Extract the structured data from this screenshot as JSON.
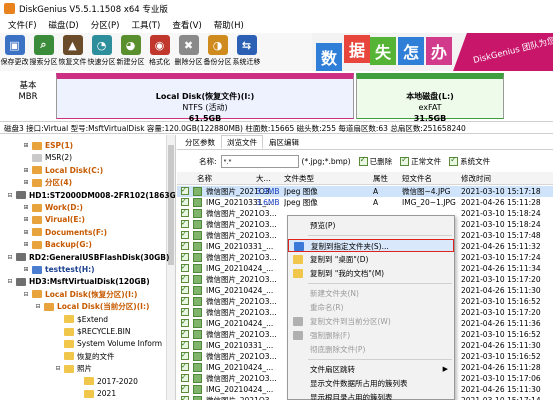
{
  "window": {
    "title": "DiskGenius V5.5.1.1508 x64 专业版"
  },
  "menu": [
    "文件(F)",
    "磁盘(D)",
    "分区(P)",
    "工具(T)",
    "查看(V)",
    "帮助(H)"
  ],
  "toolbar": [
    {
      "label": "保存更改",
      "icon": "save-icon",
      "color": "#3b72c4",
      "glyph": "▣"
    },
    {
      "label": "搜索分区",
      "icon": "search-partition-icon",
      "color": "#3a8b3a",
      "glyph": "⌕"
    },
    {
      "label": "恢复文件",
      "icon": "recover-file-icon",
      "color": "#6b4c2a",
      "glyph": "▲"
    },
    {
      "label": "快速分区",
      "icon": "quick-partition-icon",
      "color": "#2d8f9b",
      "glyph": "◔"
    },
    {
      "label": "新建分区",
      "icon": "new-partition-icon",
      "color": "#5a8f2e",
      "glyph": "◕"
    },
    {
      "label": "格式化",
      "icon": "format-icon",
      "color": "#c1372e",
      "glyph": "◉"
    },
    {
      "label": "删除分区",
      "icon": "delete-partition-icon",
      "color": "#8a8a8a",
      "glyph": "✖"
    },
    {
      "label": "备份分区",
      "icon": "backup-partition-icon",
      "color": "#d08b1f",
      "glyph": "◑"
    },
    {
      "label": "系统迁移",
      "icon": "system-migrate-icon",
      "color": "#2b60b5",
      "glyph": "⇆"
    }
  ],
  "banner": {
    "tiles": [
      {
        "char": "数",
        "color": "#2f7ed8"
      },
      {
        "char": "据",
        "color": "#e8453c"
      },
      {
        "char": "失",
        "color": "#55b435"
      },
      {
        "char": "怎",
        "color": "#2f7ed8"
      },
      {
        "char": "办",
        "color": "#d23b8c"
      }
    ],
    "ribbon_text": "DiskGenius 团队为您"
  },
  "diskmap": {
    "disk_label_line1": "基本",
    "disk_label_line2": "MBR",
    "partitions": [
      {
        "name": "Local Disk(恢复文件)(I:)",
        "fs": "NTFS (活动)",
        "size": "61.5GB",
        "color": "#eef2ff",
        "bar": "#cd2f82"
      },
      {
        "name": "本地磁盘(L:)",
        "fs": "exFAT",
        "size": "31.5GB",
        "color": "#eefbea",
        "bar": "#3f9f3f"
      }
    ]
  },
  "diskinfo": "磁盘3 接口:Virtual  型号:MsftVirtualDisk  容量:120.0GB(122880MB)  柱面数:15665  磁头数:255  每道扇区数:63  总扇区数:251658240",
  "tree": [
    {
      "exp": "⊞",
      "label": "ESP(1)",
      "style": "orange",
      "icon": "#e8a33c",
      "indent": 22
    },
    {
      "exp": "",
      "label": "MSR(2)",
      "style": "plain",
      "icon": "#c9c9c9",
      "indent": 22
    },
    {
      "exp": "⊞",
      "label": "Local Disk(C:)",
      "style": "orange",
      "icon": "#e8a33c",
      "indent": 22
    },
    {
      "exp": "⊞",
      "label": "分区(4)",
      "style": "orange",
      "icon": "#e8a33c",
      "indent": 22
    },
    {
      "exp": "⊟",
      "label": "HD1:ST2000DM008-2FR102(1863G",
      "style": "disk",
      "icon": "#6f6f6f",
      "indent": 6
    },
    {
      "exp": "⊞",
      "label": "Work(D:)",
      "style": "orange",
      "icon": "#e8a33c",
      "indent": 22
    },
    {
      "exp": "⊞",
      "label": "Virual(E:)",
      "style": "orange",
      "icon": "#e8a33c",
      "indent": 22
    },
    {
      "exp": "⊞",
      "label": "Documents(F:)",
      "style": "orange",
      "icon": "#e8a33c",
      "indent": 22
    },
    {
      "exp": "⊞",
      "label": "Backup(G:)",
      "style": "orange",
      "icon": "#e8a33c",
      "indent": 22
    },
    {
      "exp": "⊟",
      "label": "RD2:GeneralUSBFlashDisk(30GB)",
      "style": "disk",
      "icon": "#6f6f6f",
      "indent": 6
    },
    {
      "exp": "⊞",
      "label": "testtest(H:)",
      "style": "blue",
      "icon": "#4a7ccf",
      "indent": 22
    },
    {
      "exp": "⊟",
      "label": "HD3:MsftVirtualDisk(120GB)",
      "style": "disk",
      "icon": "#6f6f6f",
      "indent": 6
    },
    {
      "exp": "⊟",
      "label": "Local Disk(恢复分区)(I:)",
      "style": "orange",
      "icon": "#e8a33c",
      "indent": 22
    },
    {
      "exp": "⊟",
      "label": "Local Disk(当前分区)(I:)",
      "style": "orange",
      "icon": "#e8a33c",
      "indent": 34
    },
    {
      "exp": "",
      "label": "$Extend",
      "style": "plain",
      "icon": "#f0c74a",
      "indent": 54
    },
    {
      "exp": "",
      "label": "$RECYCLE.BIN",
      "style": "plain",
      "icon": "#f0c74a",
      "indent": 54
    },
    {
      "exp": "",
      "label": "System Volume Inform",
      "style": "plain",
      "icon": "#f0c74a",
      "indent": 54
    },
    {
      "exp": "",
      "label": "恢复的文件",
      "style": "plain",
      "icon": "#f0c74a",
      "indent": 54
    },
    {
      "exp": "⊟",
      "label": "照片",
      "style": "plain",
      "icon": "#f0c74a",
      "indent": 54
    },
    {
      "exp": "",
      "label": "2017-2020",
      "style": "plain",
      "icon": "#f0c74a",
      "indent": 74
    },
    {
      "exp": "",
      "label": "2021",
      "style": "plain",
      "icon": "#f0c74a",
      "indent": 74
    }
  ],
  "tabs": [
    "分区参数",
    "浏览文件",
    "扇区编辑"
  ],
  "filter": {
    "name_label": "名称:",
    "name_value": "*.*",
    "name_hint": "(*.jpg;*.bmp)",
    "options": [
      "已删除",
      "正常文件",
      "系统文件"
    ]
  },
  "columns": [
    "名称",
    "大...",
    "文件类型",
    "属性",
    "短文件名",
    "修改时间"
  ],
  "rows": [
    {
      "name": "微信图片_2021O3...",
      "size": "3.9MB",
      "type": "Jpeg 图像",
      "attr": "A",
      "short": "微信图~4.JPG",
      "time": "2021-03-10 15:17:18"
    },
    {
      "name": "IMG_20210331_...",
      "size": "3.6MB",
      "type": "Jpeg 图像",
      "attr": "A",
      "short": "IMG_20~1.JPG",
      "time": "2021-04-26 15:11:28"
    },
    {
      "name": "微信图片_2021O3...",
      "size": "",
      "type": "",
      "attr": "",
      "short": "",
      "time": "2021-03-10 15:18:24"
    },
    {
      "name": "微信图片_2021O3...",
      "size": "",
      "type": "",
      "attr": "",
      "short": "",
      "time": "2021-03-10 15:18:24"
    },
    {
      "name": "微信图片_2021O3...",
      "size": "",
      "type": "",
      "attr": "",
      "short": "",
      "time": "2021-03-10 15:17:48"
    },
    {
      "name": "IMG_20210331_...",
      "size": "",
      "type": "",
      "attr": "",
      "short": "",
      "time": "2021-04-26 15:11:32"
    },
    {
      "name": "微信图片_2021O3...",
      "size": "",
      "type": "",
      "attr": "",
      "short": "",
      "time": "2021-03-10 15:17:24"
    },
    {
      "name": "IMG_20210424_...",
      "size": "",
      "type": "",
      "attr": "",
      "short": "",
      "time": "2021-04-26 15:11:34"
    },
    {
      "name": "微信图片_2021O3...",
      "size": "",
      "type": "",
      "attr": "",
      "short": "",
      "time": "2021-03-10 15:17:20"
    },
    {
      "name": "IMG_20210424_...",
      "size": "",
      "type": "",
      "attr": "",
      "short": "",
      "time": "2021-04-26 15:11:30"
    },
    {
      "name": "微信图片_2021O3...",
      "size": "",
      "type": "",
      "attr": "",
      "short": "",
      "time": "2021-03-10 15:16:52"
    },
    {
      "name": "微信图片_2021O3...",
      "size": "",
      "type": "",
      "attr": "",
      "short": "",
      "time": "2021-03-10 15:17:20"
    },
    {
      "name": "IMG_20210424_...",
      "size": "",
      "type": "",
      "attr": "",
      "short": "",
      "time": "2021-04-26 15:11:36"
    },
    {
      "name": "微信图片_2021O3...",
      "size": "",
      "type": "",
      "attr": "",
      "short": "",
      "time": "2021-03-10 15:16:52"
    },
    {
      "name": "IMG_20210331_...",
      "size": "",
      "type": "",
      "attr": "",
      "short": "",
      "time": "2021-04-26 15:11:30"
    },
    {
      "name": "微信图片_2021O3...",
      "size": "",
      "type": "",
      "attr": "",
      "short": "",
      "time": "2021-03-10 15:16:52"
    },
    {
      "name": "IMG_20210424_...",
      "size": "",
      "type": "",
      "attr": "",
      "short": "",
      "time": "2021-04-26 15:11:28"
    },
    {
      "name": "微信图片_2021O3...",
      "size": "",
      "type": "",
      "attr": "",
      "short": "",
      "time": "2021-03-10 15:17:06"
    },
    {
      "name": "IMG_20210424_...",
      "size": "",
      "type": "",
      "attr": "",
      "short": "",
      "time": "2021-04-26 15:11:30"
    },
    {
      "name": "微信图片_2021O3...",
      "size": "",
      "type": "",
      "attr": "",
      "short": "",
      "time": "2021-03-10 15:17:14"
    }
  ],
  "context_menu": [
    {
      "label": "预览(P)",
      "disabled": false,
      "icon": "",
      "highlight": false
    },
    {
      "sep": true
    },
    {
      "label": "复制到指定文件夹(S)...",
      "disabled": false,
      "icon": "#3b78d8",
      "highlight": true
    },
    {
      "label": "复制到 \"桌面\"(D)",
      "disabled": false,
      "icon": "#f0c74a",
      "highlight": false
    },
    {
      "label": "复制到 \"我的文档\"(M)",
      "disabled": false,
      "icon": "#f0c74a",
      "highlight": false
    },
    {
      "sep": true
    },
    {
      "label": "新建文件夹(N)",
      "disabled": true,
      "icon": "",
      "highlight": false
    },
    {
      "label": "重命名(R)",
      "disabled": true,
      "icon": "",
      "highlight": false
    },
    {
      "label": "复制文件到当前分区(W)",
      "disabled": true,
      "icon": "#b0b0b0",
      "highlight": false
    },
    {
      "label": "强制删除(F)",
      "disabled": true,
      "icon": "#b0b0b0",
      "highlight": false
    },
    {
      "label": "彻底删除文件(P)",
      "disabled": true,
      "icon": "",
      "highlight": false
    },
    {
      "sep": true
    },
    {
      "label": "文件扇区跳转",
      "disabled": false,
      "icon": "",
      "highlight": false,
      "submenu": true
    },
    {
      "label": "显示文件数据所占用的簇列表",
      "disabled": false,
      "icon": "",
      "highlight": false
    },
    {
      "label": "显示根目录占用的簇列表",
      "disabled": false,
      "icon": "",
      "highlight": false
    }
  ]
}
